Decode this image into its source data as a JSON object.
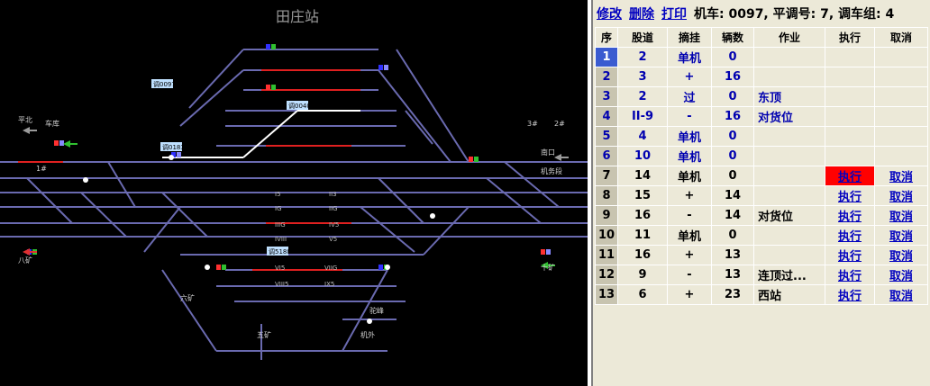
{
  "map": {
    "title": "田庄站",
    "labels": [
      "平北",
      "南口",
      "机务段",
      "八矿",
      "十矿",
      "六矿",
      "五矿",
      "机外",
      "驼峰",
      "车库",
      "3#",
      "2#",
      "1#"
    ],
    "track_labels": [
      "I5",
      "IG",
      "II3",
      "IIG",
      "IIIG",
      "IV5",
      "IVIII",
      "V5",
      "VI5",
      "VIIG",
      "VIII5",
      "IX5"
    ],
    "trains": [
      "调0097",
      "调0040",
      "调0183",
      "调5188"
    ]
  },
  "toolbar": {
    "edit": "修改",
    "delete": "删除",
    "print": "打印",
    "info": "机车: 0097, 平调号: 7, 调车组: 4"
  },
  "columns": [
    "序",
    "股道",
    "摘挂",
    "辆数",
    "作业",
    "执行",
    "取消"
  ],
  "rows": [
    {
      "seq": "1",
      "track": "2",
      "op": "单机",
      "cars": "0",
      "job": "",
      "exec": "",
      "cancel": ""
    },
    {
      "seq": "2",
      "track": "3",
      "op": "+",
      "cars": "16",
      "job": "",
      "exec": "",
      "cancel": ""
    },
    {
      "seq": "3",
      "track": "2",
      "op": "过",
      "cars": "0",
      "job": "东顶",
      "exec": "",
      "cancel": ""
    },
    {
      "seq": "4",
      "track": "II-9",
      "op": "-",
      "cars": "16",
      "job": "对货位",
      "exec": "",
      "cancel": ""
    },
    {
      "seq": "5",
      "track": "4",
      "op": "单机",
      "cars": "0",
      "job": "",
      "exec": "",
      "cancel": ""
    },
    {
      "seq": "6",
      "track": "10",
      "op": "单机",
      "cars": "0",
      "job": "",
      "exec": "",
      "cancel": ""
    },
    {
      "seq": "7",
      "track": "14",
      "op": "单机",
      "cars": "0",
      "job": "",
      "exec": "执行",
      "cancel": "取消"
    },
    {
      "seq": "8",
      "track": "15",
      "op": "+",
      "cars": "14",
      "job": "",
      "exec": "执行",
      "cancel": "取消"
    },
    {
      "seq": "9",
      "track": "16",
      "op": "-",
      "cars": "14",
      "job": "对货位",
      "exec": "执行",
      "cancel": "取消"
    },
    {
      "seq": "10",
      "track": "11",
      "op": "单机",
      "cars": "0",
      "job": "",
      "exec": "执行",
      "cancel": "取消"
    },
    {
      "seq": "11",
      "track": "16",
      "op": "+",
      "cars": "13",
      "job": "",
      "exec": "执行",
      "cancel": "取消"
    },
    {
      "seq": "12",
      "track": "9",
      "op": "-",
      "cars": "13",
      "job": "连顶过...",
      "exec": "执行",
      "cancel": "取消"
    },
    {
      "seq": "13",
      "track": "6",
      "op": "+",
      "cars": "23",
      "job": "西站",
      "exec": "执行",
      "cancel": "取消"
    }
  ],
  "colors": {
    "map_bg": "#000000",
    "track": "#6A6AB0",
    "panel": "#ECE9D8",
    "highlight": "#FF0000",
    "link": "#0000C0"
  }
}
